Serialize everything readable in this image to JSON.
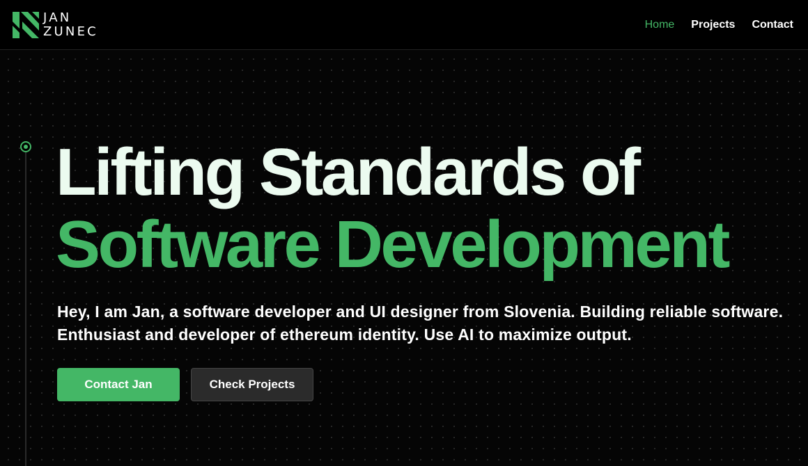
{
  "header": {
    "logo": {
      "line1": "JAN",
      "line2": "ZUNEC"
    },
    "nav": [
      {
        "label": "Home",
        "active": true
      },
      {
        "label": "Projects",
        "active": false
      },
      {
        "label": "Contact",
        "active": false
      }
    ]
  },
  "hero": {
    "headline_line1": "Lifting Standards of",
    "headline_line2": "Software Development",
    "intro": "Hey, I am Jan, a software developer and UI designer from Slovenia. Building reliable software. Enthusiast and developer of ethereum identity. Use AI to maximize output.",
    "primary_button": "Contact Jan",
    "secondary_button": "Check Projects"
  },
  "colors": {
    "accent": "#44b766",
    "background": "#000000",
    "headline_light": "#ecfbf0"
  },
  "icons": {
    "logo": "jz-logo-mark-icon",
    "timeline": "timeline-dot-icon"
  }
}
